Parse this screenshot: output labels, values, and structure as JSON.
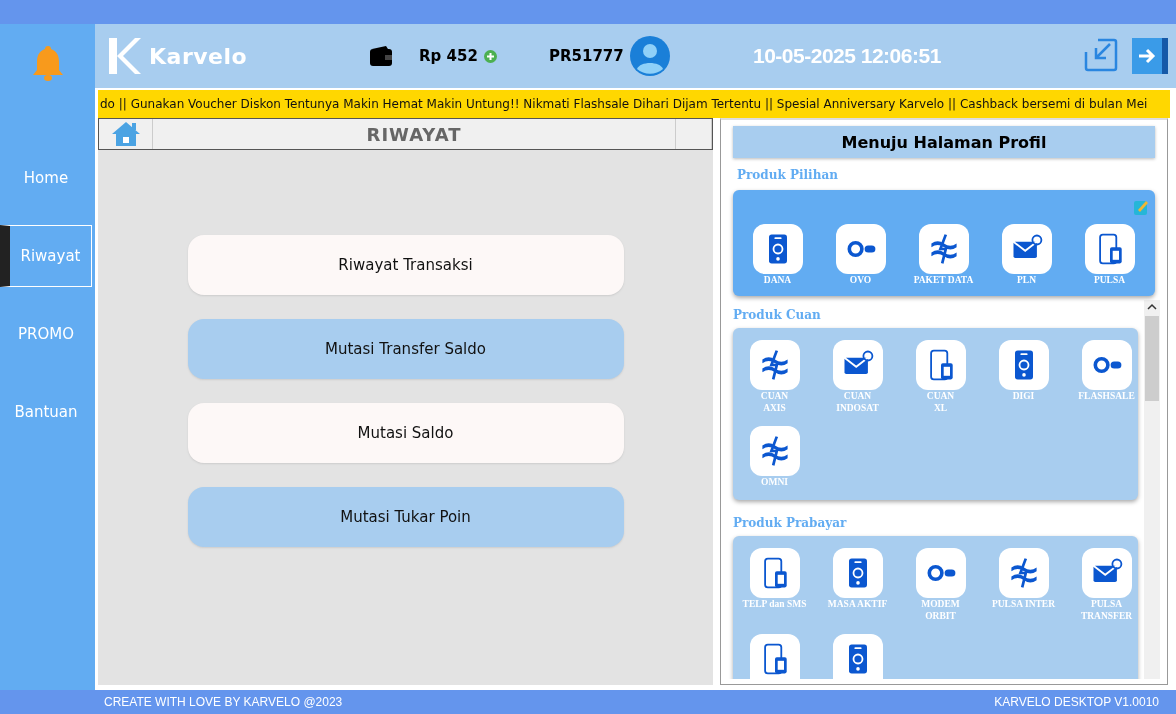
{
  "sidebar": {
    "items": [
      {
        "label": "Home",
        "selected": false
      },
      {
        "label": "Riwayat",
        "selected": true
      },
      {
        "label": "PROMO",
        "selected": false
      },
      {
        "label": "Bantuan",
        "selected": false
      }
    ]
  },
  "header": {
    "brand": "Karvelo",
    "balance": "Rp 452",
    "user_id": "PR51777",
    "datetime": "10-05-2025 12:06:51"
  },
  "marquee": "do || Gunakan Voucher Diskon Tentunya Makin Hemat Makin Untung!! Nikmati Flashsale Dihari  Dijam Tertentu || Spesial Anniversary Karvelo || Cashback bersemi di bulan Mei",
  "page": {
    "title": "RIWAYAT",
    "buttons": [
      "Riwayat Transaksi",
      "Mutasi Transfer Saldo",
      "Mutasi Saldo",
      "Mutasi Tukar Poin"
    ]
  },
  "profile_button": "Menuju Halaman Profil",
  "sections": [
    {
      "title": "Produk Pilihan",
      "kind": "featured",
      "items": [
        {
          "lines": [
            "DANA"
          ]
        },
        {
          "lines": [
            "OVO"
          ]
        },
        {
          "lines": [
            "PAKET DATA"
          ]
        },
        {
          "lines": [
            "PLN"
          ]
        },
        {
          "lines": [
            "PULSA"
          ]
        }
      ]
    },
    {
      "title": "Produk Cuan",
      "kind": "normal",
      "items": [
        {
          "lines": [
            "CUAN",
            "AXIS"
          ]
        },
        {
          "lines": [
            "CUAN",
            "INDOSAT"
          ]
        },
        {
          "lines": [
            "CUAN",
            "XL"
          ]
        },
        {
          "lines": [
            "DIGI"
          ]
        },
        {
          "lines": [
            "FLASHSALE"
          ]
        },
        {
          "lines": [
            "OMNI"
          ]
        }
      ]
    },
    {
      "title": "Produk Prabayar",
      "kind": "normal",
      "items": [
        {
          "lines": [
            "TELP dan SMS"
          ]
        },
        {
          "lines": [
            "MASA AKTIF"
          ]
        },
        {
          "lines": [
            "MODEM",
            "ORBIT"
          ]
        },
        {
          "lines": [
            "PULSA INTER"
          ]
        },
        {
          "lines": [
            "PULSA",
            "TRANSFER"
          ]
        },
        {
          "kind": "partial"
        },
        {
          "kind": "partial"
        }
      ]
    }
  ],
  "footer": {
    "left": "CREATE WITH LOVE BY KARVELO @2023",
    "right": "KARVELO DESKTOP V1.0010"
  }
}
